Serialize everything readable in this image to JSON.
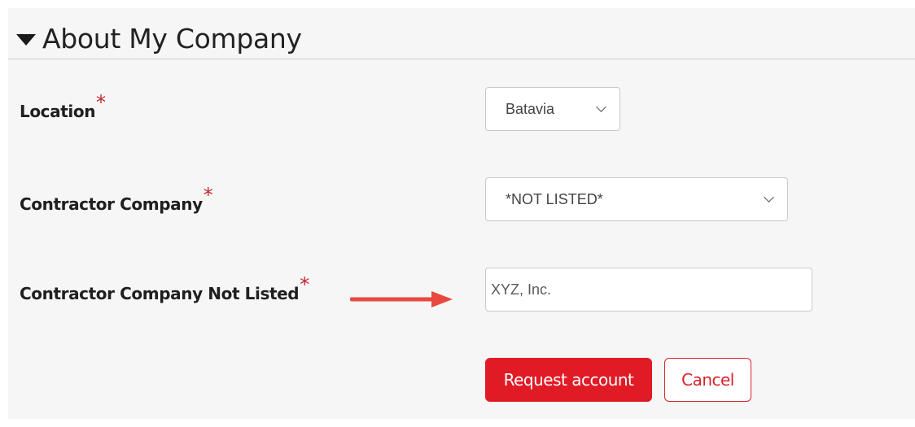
{
  "section": {
    "title": "About My Company"
  },
  "fields": {
    "location": {
      "label": "Location",
      "required_mark": "*",
      "value": "Batavia"
    },
    "contractor_company": {
      "label": "Contractor Company",
      "required_mark": "*",
      "value": "*NOT LISTED*"
    },
    "contractor_not_listed": {
      "label": "Contractor Company Not Listed",
      "required_mark": "*",
      "placeholder": "XYZ, Inc."
    }
  },
  "actions": {
    "request_label": "Request account",
    "cancel_label": "Cancel"
  },
  "colors": {
    "accent": "#e11b26",
    "required": "#c0282f",
    "annotation_arrow": "#e8483f"
  },
  "icons": {
    "section_toggle": "caret-down-icon",
    "dropdown": "chevron-down-icon",
    "annotation": "arrow-right-icon"
  }
}
